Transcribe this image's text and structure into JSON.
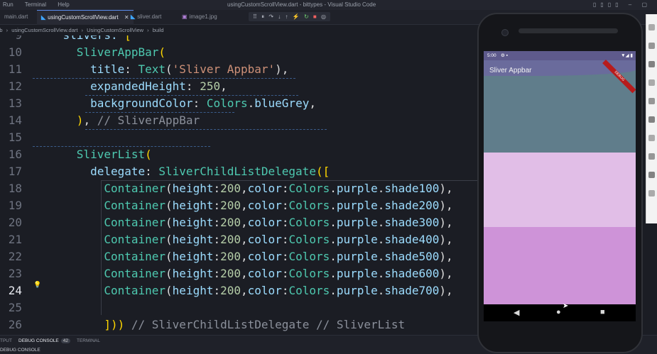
{
  "titlebar": {
    "menu": [
      "Run",
      "Terminal",
      "Help"
    ],
    "window_title": "usingCustomScrollView.dart - bittypes - Visual Studio Code"
  },
  "tabs": [
    {
      "label": "main.dart",
      "dart": false,
      "closable": false,
      "active": false
    },
    {
      "label": "usingCustomScrollView.dart",
      "dart": true,
      "closable": true,
      "active": true
    },
    {
      "label": "sliver.dart",
      "dart": true,
      "closable": false,
      "active": false
    },
    {
      "label": "image1.jpg",
      "dart": false,
      "closable": false,
      "active": false
    }
  ],
  "debug_toolbar": [
    "⠿",
    "⏸",
    "↷",
    "↓",
    "↑",
    "⚡",
    "↻",
    "■",
    "◎"
  ],
  "breadcrumb": {
    "items": [
      "lib",
      "usingCustomScrollView.dart",
      "UsingCustomScrollView",
      "build"
    ],
    "separators": [
      "›",
      "›",
      "›"
    ]
  },
  "editor": {
    "current_line": 24,
    "lines": [
      {
        "n": "9",
        "tokens": [
          {
            "c": "p",
            "t": "    slivers: "
          },
          {
            "c": "y",
            "t": "["
          }
        ]
      },
      {
        "n": "10",
        "tokens": [
          {
            "c": "k",
            "t": "      SliverAppBar"
          },
          {
            "c": "y",
            "t": "("
          }
        ]
      },
      {
        "n": "11",
        "tokens": [
          {
            "c": "p",
            "t": "        title"
          },
          {
            "c": "t",
            "t": ": "
          },
          {
            "c": "k",
            "t": "Text"
          },
          {
            "c": "t",
            "t": "("
          },
          {
            "c": "s",
            "t": "'Sliver Appbar'"
          },
          {
            "c": "t",
            "t": "),"
          }
        ]
      },
      {
        "n": "12",
        "tokens": [
          {
            "c": "p",
            "t": "        expandedHeight"
          },
          {
            "c": "t",
            "t": ": "
          },
          {
            "c": "n",
            "t": "250"
          },
          {
            "c": "t",
            "t": ","
          }
        ]
      },
      {
        "n": "13",
        "tokens": [
          {
            "c": "p",
            "t": "        backgroundColor"
          },
          {
            "c": "t",
            "t": ": "
          },
          {
            "c": "k",
            "t": "Colors"
          },
          {
            "c": "t",
            "t": "."
          },
          {
            "c": "p",
            "t": "blueGrey"
          },
          {
            "c": "t",
            "t": ","
          }
        ]
      },
      {
        "n": "14",
        "tokens": [
          {
            "c": "y",
            "t": "      )"
          },
          {
            "c": "t",
            "t": ", "
          },
          {
            "c": "c",
            "t": "// SliverAppBar"
          }
        ]
      },
      {
        "n": "15",
        "tokens": []
      },
      {
        "n": "16",
        "tokens": [
          {
            "c": "k",
            "t": "      SliverList"
          },
          {
            "c": "y",
            "t": "("
          }
        ]
      },
      {
        "n": "17",
        "tokens": [
          {
            "c": "p",
            "t": "        delegate"
          },
          {
            "c": "t",
            "t": ": "
          },
          {
            "c": "k",
            "t": "SliverChildListDelegate"
          },
          {
            "c": "y",
            "t": "(["
          }
        ]
      },
      {
        "n": "18",
        "tokens": [
          {
            "c": "k",
            "t": "          Container"
          },
          {
            "c": "t",
            "t": "("
          },
          {
            "c": "p",
            "t": "height"
          },
          {
            "c": "t",
            "t": ":"
          },
          {
            "c": "n",
            "t": "200"
          },
          {
            "c": "t",
            "t": ","
          },
          {
            "c": "p",
            "t": "color"
          },
          {
            "c": "t",
            "t": ":"
          },
          {
            "c": "k",
            "t": "Colors"
          },
          {
            "c": "t",
            "t": "."
          },
          {
            "c": "p",
            "t": "purple"
          },
          {
            "c": "t",
            "t": "."
          },
          {
            "c": "p",
            "t": "shade100"
          },
          {
            "c": "t",
            "t": "),"
          }
        ]
      },
      {
        "n": "19",
        "tokens": [
          {
            "c": "k",
            "t": "          Container"
          },
          {
            "c": "t",
            "t": "("
          },
          {
            "c": "p",
            "t": "height"
          },
          {
            "c": "t",
            "t": ":"
          },
          {
            "c": "n",
            "t": "200"
          },
          {
            "c": "t",
            "t": ","
          },
          {
            "c": "p",
            "t": "color"
          },
          {
            "c": "t",
            "t": ":"
          },
          {
            "c": "k",
            "t": "Colors"
          },
          {
            "c": "t",
            "t": "."
          },
          {
            "c": "p",
            "t": "purple"
          },
          {
            "c": "t",
            "t": "."
          },
          {
            "c": "p",
            "t": "shade200"
          },
          {
            "c": "t",
            "t": "),"
          }
        ]
      },
      {
        "n": "20",
        "tokens": [
          {
            "c": "k",
            "t": "          Container"
          },
          {
            "c": "t",
            "t": "("
          },
          {
            "c": "p",
            "t": "height"
          },
          {
            "c": "t",
            "t": ":"
          },
          {
            "c": "n",
            "t": "200"
          },
          {
            "c": "t",
            "t": ","
          },
          {
            "c": "p",
            "t": "color"
          },
          {
            "c": "t",
            "t": ":"
          },
          {
            "c": "k",
            "t": "Colors"
          },
          {
            "c": "t",
            "t": "."
          },
          {
            "c": "p",
            "t": "purple"
          },
          {
            "c": "t",
            "t": "."
          },
          {
            "c": "p",
            "t": "shade300"
          },
          {
            "c": "t",
            "t": "),"
          }
        ]
      },
      {
        "n": "21",
        "tokens": [
          {
            "c": "k",
            "t": "          Container"
          },
          {
            "c": "t",
            "t": "("
          },
          {
            "c": "p",
            "t": "height"
          },
          {
            "c": "t",
            "t": ":"
          },
          {
            "c": "n",
            "t": "200"
          },
          {
            "c": "t",
            "t": ","
          },
          {
            "c": "p",
            "t": "color"
          },
          {
            "c": "t",
            "t": ":"
          },
          {
            "c": "k",
            "t": "Colors"
          },
          {
            "c": "t",
            "t": "."
          },
          {
            "c": "p",
            "t": "purple"
          },
          {
            "c": "t",
            "t": "."
          },
          {
            "c": "p",
            "t": "shade400"
          },
          {
            "c": "t",
            "t": "),"
          }
        ]
      },
      {
        "n": "22",
        "tokens": [
          {
            "c": "k",
            "t": "          Container"
          },
          {
            "c": "t",
            "t": "("
          },
          {
            "c": "p",
            "t": "height"
          },
          {
            "c": "t",
            "t": ":"
          },
          {
            "c": "n",
            "t": "200"
          },
          {
            "c": "t",
            "t": ","
          },
          {
            "c": "p",
            "t": "color"
          },
          {
            "c": "t",
            "t": ":"
          },
          {
            "c": "k",
            "t": "Colors"
          },
          {
            "c": "t",
            "t": "."
          },
          {
            "c": "p",
            "t": "purple"
          },
          {
            "c": "t",
            "t": "."
          },
          {
            "c": "p",
            "t": "shade500"
          },
          {
            "c": "t",
            "t": "),"
          }
        ]
      },
      {
        "n": "23",
        "tokens": [
          {
            "c": "k",
            "t": "          Container"
          },
          {
            "c": "t",
            "t": "("
          },
          {
            "c": "p",
            "t": "height"
          },
          {
            "c": "t",
            "t": ":"
          },
          {
            "c": "n",
            "t": "200"
          },
          {
            "c": "t",
            "t": ","
          },
          {
            "c": "p",
            "t": "color"
          },
          {
            "c": "t",
            "t": ":"
          },
          {
            "c": "k",
            "t": "Colors"
          },
          {
            "c": "t",
            "t": "."
          },
          {
            "c": "p",
            "t": "purple"
          },
          {
            "c": "t",
            "t": "."
          },
          {
            "c": "p",
            "t": "shade600"
          },
          {
            "c": "t",
            "t": "),"
          }
        ]
      },
      {
        "n": "24",
        "tokens": [
          {
            "c": "k",
            "t": "          Container"
          },
          {
            "c": "t",
            "t": "("
          },
          {
            "c": "p",
            "t": "height"
          },
          {
            "c": "t",
            "t": ":"
          },
          {
            "c": "n",
            "t": "200"
          },
          {
            "c": "t",
            "t": ","
          },
          {
            "c": "p",
            "t": "color"
          },
          {
            "c": "t",
            "t": ":"
          },
          {
            "c": "k",
            "t": "Colors"
          },
          {
            "c": "t",
            "t": "."
          },
          {
            "c": "p",
            "t": "purple"
          },
          {
            "c": "t",
            "t": "."
          },
          {
            "c": "p",
            "t": "shade700"
          },
          {
            "c": "t",
            "t": "),"
          }
        ]
      },
      {
        "n": "25",
        "tokens": []
      },
      {
        "n": "26",
        "tokens": [
          {
            "c": "y",
            "t": "          ])"
          },
          {
            "c": "y",
            "t": ")"
          },
          {
            "c": "t",
            "t": " "
          },
          {
            "c": "c",
            "t": "// SliverChildListDelegate // SliverList"
          }
        ]
      }
    ]
  },
  "panel": {
    "tabs": [
      "TPUT",
      "DEBUG CONSOLE",
      "TERMINAL"
    ],
    "debug_badge": "42",
    "console_label": "DEBUG CONSOLE"
  },
  "phone": {
    "status_time": "5:00",
    "status_icons": "⚙ ▪",
    "status_right": "▼◢ ▮",
    "appbar_title": "Sliver Appbar",
    "debug_banner": "DEBUG",
    "nav": {
      "back": "◀",
      "home": "●",
      "recents": "■"
    },
    "colors": {
      "appbar": "#607d8b",
      "shade100": "#e1bee7",
      "shade200": "#ce93d8"
    }
  },
  "emulator_toolbar_count": 10
}
